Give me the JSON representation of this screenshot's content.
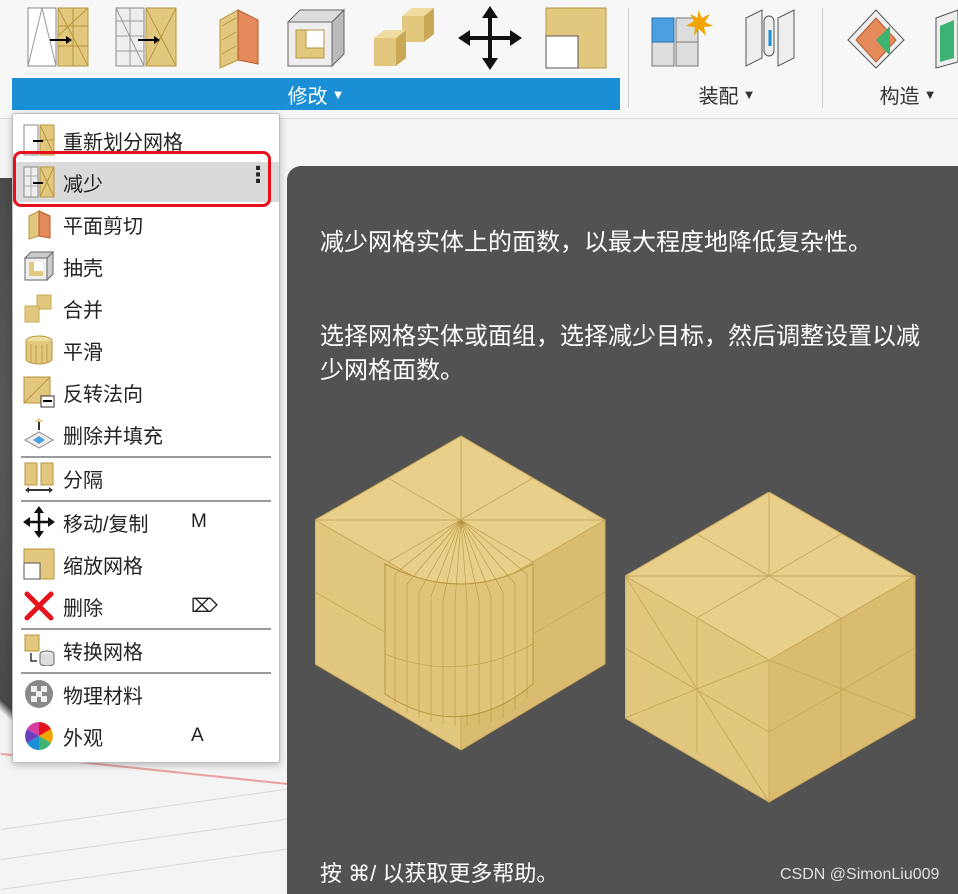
{
  "toolbar": {
    "groups": [
      {
        "label": "修改",
        "active": true
      },
      {
        "label": "装配",
        "active": false
      },
      {
        "label": "构造",
        "active": false
      }
    ],
    "caret": "▼"
  },
  "menu": {
    "items": [
      {
        "label": "重新划分网格",
        "icon": "remesh-icon",
        "shortcut": ""
      },
      {
        "label": "减少",
        "icon": "reduce-icon",
        "shortcut": "",
        "highlighted": true
      },
      {
        "label": "平面剪切",
        "icon": "plane-cut-icon",
        "shortcut": ""
      },
      {
        "label": "抽壳",
        "icon": "shell-icon",
        "shortcut": ""
      },
      {
        "label": "合并",
        "icon": "combine-icon",
        "shortcut": ""
      },
      {
        "label": "平滑",
        "icon": "smooth-icon",
        "shortcut": ""
      },
      {
        "label": "反转法向",
        "icon": "reverse-normal-icon",
        "shortcut": ""
      },
      {
        "label": "删除并填充",
        "icon": "erase-fill-icon",
        "shortcut": ""
      },
      {
        "label": "分隔",
        "icon": "separate-icon",
        "shortcut": ""
      },
      {
        "label": "移动/复制",
        "icon": "move-copy-icon",
        "shortcut": "M"
      },
      {
        "label": "缩放网格",
        "icon": "scale-mesh-icon",
        "shortcut": ""
      },
      {
        "label": "删除",
        "icon": "delete-icon",
        "shortcut": "⌦"
      },
      {
        "label": "转换网格",
        "icon": "convert-mesh-icon",
        "shortcut": ""
      },
      {
        "label": "物理材料",
        "icon": "physical-material-icon",
        "shortcut": ""
      },
      {
        "label": "外观",
        "icon": "appearance-icon",
        "shortcut": "A"
      }
    ],
    "more_icon": "kebab-icon"
  },
  "tooltip": {
    "paragraph1": "减少网格实体上的面数，以最大程度地降低复杂性。",
    "paragraph2": "选择网格实体或面组，选择减少目标，然后调整设置以减少网格面数。",
    "footer": "按 ⌘/ 以获取更多帮助。"
  },
  "watermark": "CSDN @SimonLiu009",
  "colors": {
    "accent": "#1a8fd6",
    "highlight_frame": "#e5121b",
    "tooltip_bg": "#525252",
    "mesh_tan": "#e2c77e"
  }
}
